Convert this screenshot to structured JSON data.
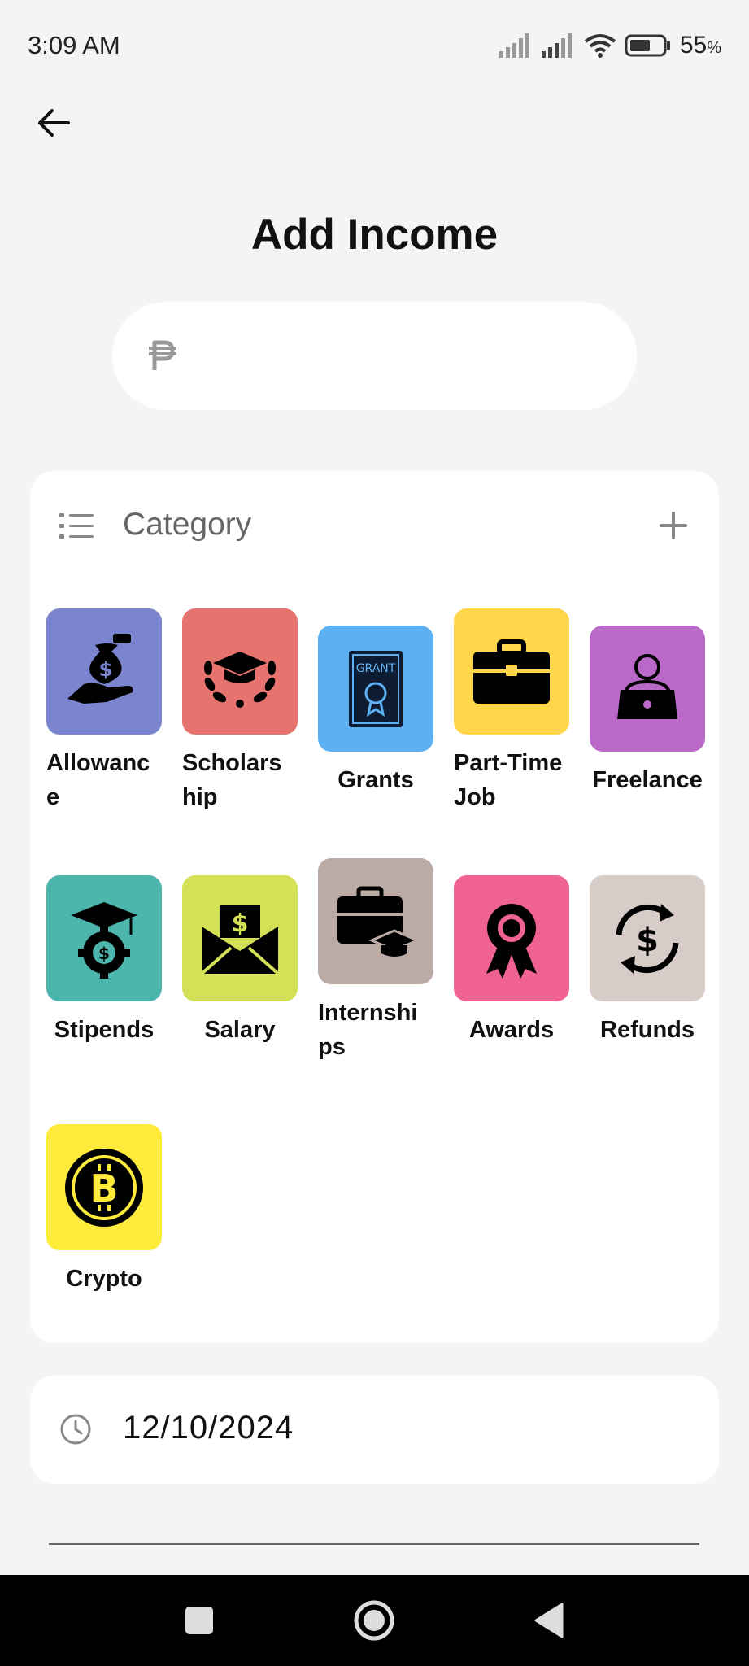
{
  "status": {
    "time": "3:09 AM",
    "battery": "55",
    "battery_unit": "%"
  },
  "title": "Add Income",
  "amount": {
    "value": "",
    "currency_icon": "peso-icon"
  },
  "category": {
    "title": "Category",
    "items": [
      {
        "label": "Allowance",
        "icon": "hand-money-bag-icon",
        "color": "#7b84cf"
      },
      {
        "label": "Scholarship",
        "icon": "graduation-laurel-icon",
        "color": "#e6736d"
      },
      {
        "label": "Grants",
        "icon": "grant-certificate-icon",
        "color": "#5db1f2"
      },
      {
        "label": "Part-Time Job",
        "icon": "briefcase-icon",
        "color": "#ffd54a"
      },
      {
        "label": "Freelance",
        "icon": "person-laptop-icon",
        "color": "#b969c8"
      },
      {
        "label": "Stipends",
        "icon": "graduation-gear-coin-icon",
        "color": "#4db6ac"
      },
      {
        "label": "Salary",
        "icon": "envelope-dollar-icon",
        "color": "#d4e157"
      },
      {
        "label": "Internships",
        "icon": "briefcase-cap-icon",
        "color": "#bcaaa4"
      },
      {
        "label": "Awards",
        "icon": "award-ribbon-icon",
        "color": "#f06292"
      },
      {
        "label": "Refunds",
        "icon": "refund-arrows-icon",
        "color": "#d7ccc8"
      },
      {
        "label": "Crypto",
        "icon": "bitcoin-icon",
        "color": "#ffeb3b"
      }
    ]
  },
  "date": "12/10/2024"
}
